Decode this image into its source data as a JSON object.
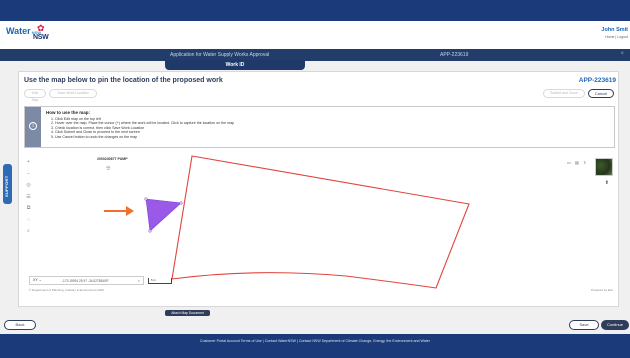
{
  "brand": {
    "water_logo": "Water",
    "water_sub": "NSW",
    "nsw_logo": "NSW"
  },
  "user": {
    "name": "John Smit",
    "links": "Home | Logout"
  },
  "titlebar": {
    "title": "Application for Water Supply Works Approval",
    "app_id": "APP-223619",
    "close_icon": "×"
  },
  "work_tab": "Work ID",
  "main": {
    "heading": "Use the map below to pin the location of the proposed work",
    "app_id": "APP-223619",
    "buttons": {
      "edit_map": "Edit Map",
      "save_work_location": "Save Work Location",
      "submit_close": "Submit and Close",
      "cancel": "Cancel"
    }
  },
  "howto": {
    "title": "How to use the map:",
    "steps": [
      "Click Edit map on the top left",
      "Hover over the map. Place the cursor (+) where the work will be located. Click to capture the location on the map",
      "Check location is correct, then click Save Work Location",
      "Click Submit and Close to proceed to the next screen",
      "Use Cancel button to undo the changes on the map"
    ]
  },
  "map": {
    "tools": [
      "+",
      "−",
      "◎",
      "☰",
      "⧉",
      "◌",
      "⌕"
    ],
    "pump_label": "2000240877 PUMP",
    "pump_icon": "⯐",
    "right_controls": [
      "▭",
      "▤",
      "⇧"
    ],
    "compass": "⬆",
    "coord_select": "XY",
    "coord_value": "-173.19991 25.97 -34.02758409°",
    "coord_close": "×",
    "scale_label": "5 m",
    "copyright": "© Department of Planning, Industry & Environment 2020",
    "powered_by": "Powered by Esri"
  },
  "support_tab": "SUPPORT",
  "attach_button": "Attach Map Document",
  "nav": {
    "back": "Back",
    "save": "Save",
    "continue": "Continue"
  },
  "footer": "Customer Portal Account  Terms of Use  |  Contact WaterNSW  |  Contact NSW Department of Climate Change, Energy, the Environment and Water",
  "colors": {
    "navy": "#1b3a7a",
    "parcel_outline": "#e0453e",
    "marker_fill": "#9b59e8",
    "arrow": "#f07030"
  }
}
